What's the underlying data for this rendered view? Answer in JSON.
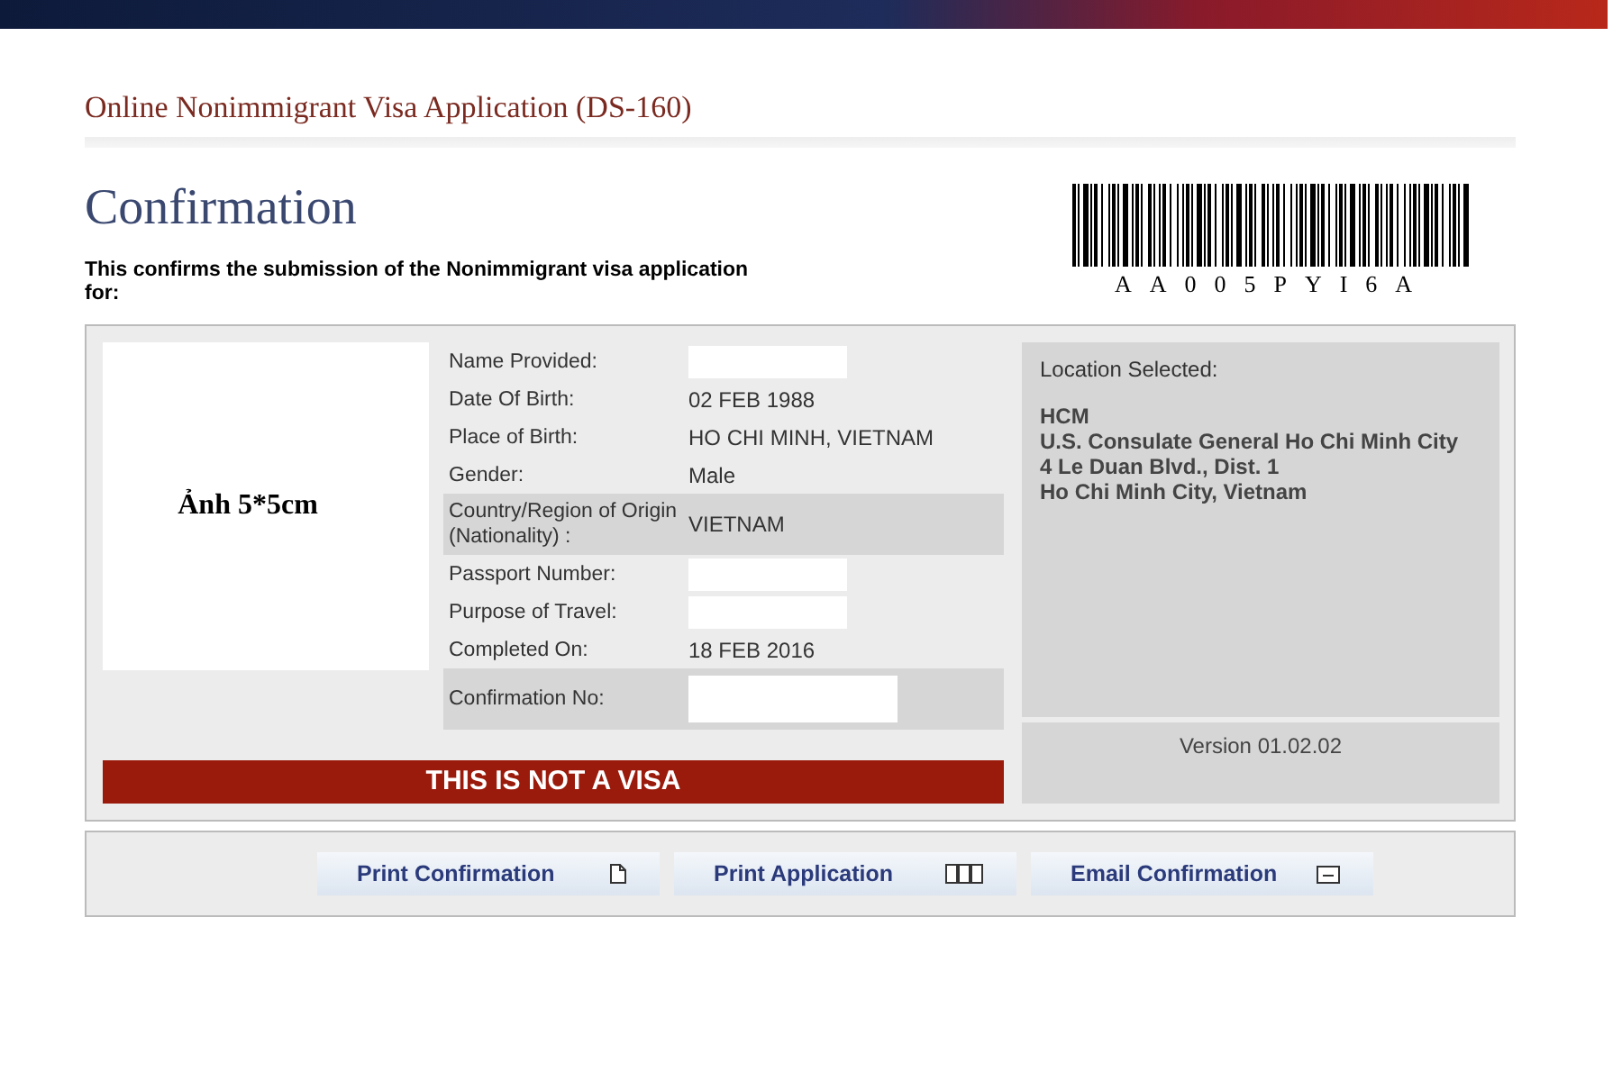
{
  "page_title": "Online Nonimmigrant Visa Application (DS-160)",
  "heading": "Confirmation",
  "intro": "This confirms the submission of the Nonimmigrant visa application for:",
  "barcode_text": "AA005PYI6A",
  "photo_label": "Ảnh 5*5cm",
  "details": [
    {
      "label": "Name Provided:",
      "kind": "blank",
      "shaded": false
    },
    {
      "label": "Date Of Birth:",
      "kind": "text",
      "value": "02 FEB 1988",
      "shaded": false
    },
    {
      "label": "Place of Birth:",
      "kind": "text",
      "value": "HO CHI MINH, VIETNAM",
      "shaded": false
    },
    {
      "label": "Gender:",
      "kind": "text",
      "value": "Male",
      "shaded": false
    },
    {
      "label": "Country/Region of Origin (Nationality) :",
      "kind": "text",
      "value": "VIETNAM",
      "shaded": true
    },
    {
      "label": "Passport Number:",
      "kind": "blank",
      "shaded": false
    },
    {
      "label": "Purpose of Travel:",
      "kind": "blank",
      "shaded": false
    },
    {
      "label": "Completed On:",
      "kind": "text",
      "value": "18 FEB 2016",
      "shaded": false
    },
    {
      "label": "Confirmation No:",
      "kind": "blank",
      "shaded": true
    }
  ],
  "not_visa": "THIS IS NOT A VISA",
  "location": {
    "label": "Location Selected:",
    "lines": [
      "HCM",
      "U.S. Consulate General Ho Chi Minh City",
      "4 Le Duan Blvd., Dist. 1",
      "Ho Chi Minh City, Vietnam"
    ]
  },
  "version": "Version 01.02.02",
  "buttons": [
    {
      "label": "Print Confirmation",
      "kind": "page"
    },
    {
      "label": "Print Application",
      "kind": "pages"
    },
    {
      "label": "Email Confirmation",
      "kind": "mail"
    }
  ]
}
